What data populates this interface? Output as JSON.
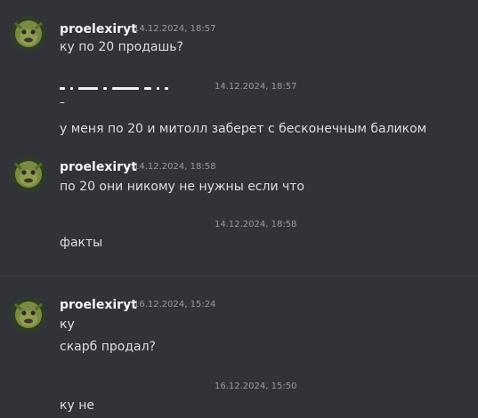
{
  "messages": {
    "m1": {
      "author": "proelexiryt",
      "timestamp": "14.12.2024, 18:57",
      "line1": "ку по 20 продашь?"
    },
    "m2": {
      "author_marker": "–",
      "timestamp": "14.12.2024, 18:57",
      "line1": "у меня по 20 и митолл заберет с бесконечным баликом"
    },
    "m3": {
      "author": "proelexiryt",
      "timestamp": "14.12.2024, 18:58",
      "line1": "по 20 они никому не нужны если что"
    },
    "m4": {
      "timestamp": "14.12.2024, 18:58",
      "line1": "факты"
    },
    "m5": {
      "author": "proelexiryt",
      "timestamp": "16.12.2024, 15:24",
      "line1": "ку",
      "line2": "скарб продал?"
    },
    "m6": {
      "timestamp": "16.12.2024, 15:50",
      "line1": "ку не"
    }
  },
  "colors": {
    "background": "#313338",
    "text": "#dbdee1",
    "author": "#f2f3f5",
    "timestamp": "#949ba4",
    "divider": "#3f4147"
  },
  "icons": {
    "avatar": "shrek-avatar-icon"
  }
}
